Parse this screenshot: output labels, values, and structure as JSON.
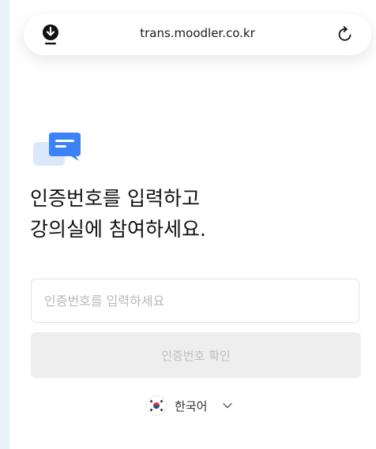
{
  "browser": {
    "url": "trans.moodler.co.kr"
  },
  "main": {
    "headline_line1": "인증번호를 입력하고",
    "headline_line2": "강의실에 참여하세요.",
    "code_placeholder": "인증번호를 입력하세요",
    "confirm_label": "인증번호 확인",
    "language_label": "한국어"
  },
  "icons": {
    "download": "download-icon",
    "reload": "reload-icon",
    "chat": "chat-bubbles-icon",
    "flag": "korea-flag-icon",
    "chevron": "chevron-down-icon"
  },
  "colors": {
    "page_bg": "#e8f2fb",
    "accent": "#3b82f6",
    "accent_light": "#dbe8fb",
    "button_disabled_bg": "#eeeeee",
    "button_disabled_text": "#bdbdbd"
  }
}
